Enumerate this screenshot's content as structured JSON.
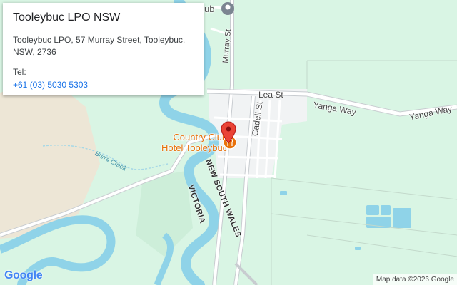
{
  "info_card": {
    "title": "Tooleybuc LPO NSW",
    "address_line1": "Tooleybuc LPO, 57 Murray Street, Tooleybuc,",
    "address_line2": "NSW, 2736",
    "tel_label": "Tel:",
    "tel_number": "+61 (03) 5030 5303"
  },
  "map_labels": {
    "murray_st": "Murray St",
    "lea_st": "Lea St",
    "yanga_way_1": "Yanga Way",
    "yanga_way_2": "Yanga Way",
    "cadell_st": "Cadell St",
    "burra_creek": "Burra Creek",
    "victoria": "VICTORIA",
    "nsw": "NEW SOUTH WALES",
    "poi_name_line1": "Country Club",
    "poi_name_line2": "Hotel Tooleybuc",
    "club_fragment": "ub"
  },
  "footer": {
    "logo_text": "Google",
    "attribution": "Map data ©2026 Google"
  },
  "colors": {
    "land": "#d9f5e4",
    "river": "#8fd3e8",
    "road": "#ffffff",
    "road_outline": "#c8ccd0",
    "town_area": "#f1f3f4",
    "sand": "#ede6d6",
    "poi_orange": "#e8710a",
    "pin_red": "#ea4335",
    "link_blue": "#1a73e8"
  }
}
